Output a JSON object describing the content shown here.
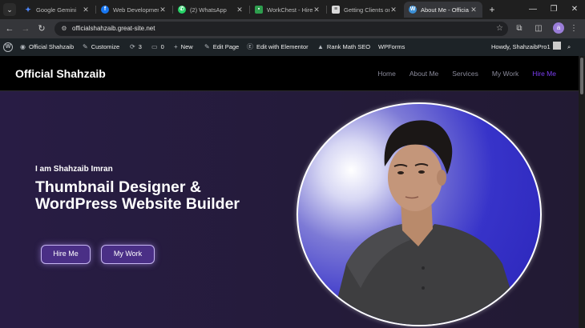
{
  "browser": {
    "tabs": [
      {
        "title": "Google Gemini",
        "favicon": "gemini-icon",
        "color": "#4e86f7"
      },
      {
        "title": "Web Development",
        "favicon": "facebook-icon",
        "color": "#1877f2"
      },
      {
        "title": "(2) WhatsApp",
        "favicon": "whatsapp-icon",
        "color": "#25d366"
      },
      {
        "title": "WorkChest - Hire",
        "favicon": "workchest-icon",
        "color": "#2e9e4e"
      },
      {
        "title": "Getting Clients on",
        "favicon": "article-icon",
        "color": "#d9d9d9"
      },
      {
        "title": "About Me - Officia",
        "favicon": "wordpress-icon",
        "color": "#3b8fd6",
        "active": true
      }
    ],
    "new_tab": "+",
    "url": "officialshahzaib.great-site.net"
  },
  "adminbar": {
    "site_name": "Official Shahzaib",
    "customize": "Customize",
    "updates_count": "3",
    "comments_count": "0",
    "new": "New",
    "edit_page": "Edit Page",
    "elementor": "Edit with Elementor",
    "rankmath": "Rank Math SEO",
    "wpforms": "WPForms",
    "howdy": "Howdy, ShahzaibPro1"
  },
  "site": {
    "logo": "Official Shahzaib",
    "nav": [
      {
        "label": "Home"
      },
      {
        "label": "About Me"
      },
      {
        "label": "Services"
      },
      {
        "label": "My Work"
      },
      {
        "label": "Hire Me",
        "active": true
      }
    ],
    "accent": "#7b3ff2"
  },
  "hero": {
    "intro": "I am Shahzaib Imran",
    "headline": "Thumbnail Designer & WordPress Website Builder",
    "hire_button": "Hire Me",
    "work_button": "My Work"
  }
}
